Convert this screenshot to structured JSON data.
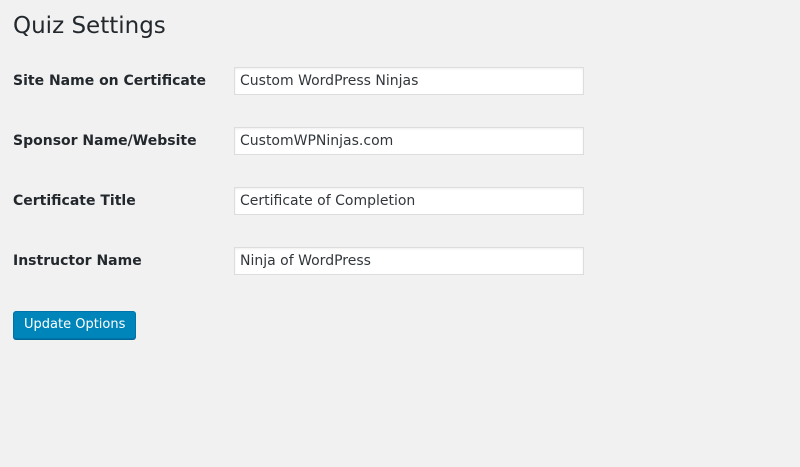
{
  "page": {
    "title": "Quiz Settings"
  },
  "form": {
    "fields": [
      {
        "label": "Site Name on Certificate",
        "value": "Custom WordPress Ninjas"
      },
      {
        "label": "Sponsor Name/Website",
        "value": "CustomWPNinjas.com"
      },
      {
        "label": "Certificate Title",
        "value": "Certificate of Completion"
      },
      {
        "label": "Instructor Name",
        "value": "Ninja of WordPress"
      }
    ],
    "submit_label": "Update Options"
  },
  "colors": {
    "background": "#f1f1f1",
    "button": "#0085ba",
    "button_border": "#0073aa"
  }
}
